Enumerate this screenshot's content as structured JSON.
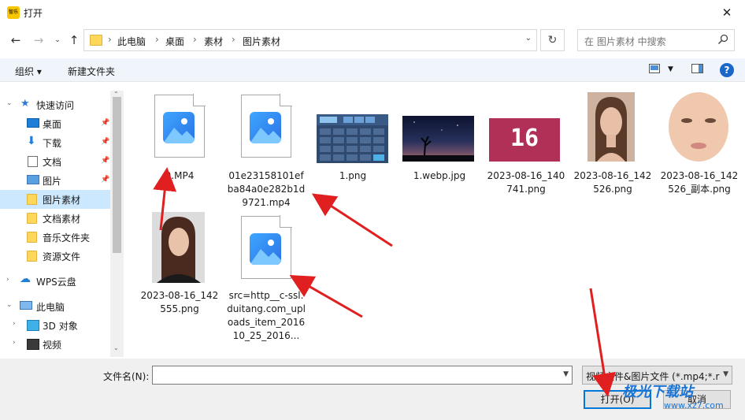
{
  "window": {
    "title": "打开",
    "app_icon_text": "智乐",
    "close_label": "✕"
  },
  "nav": {
    "breadcrumbs": [
      "此电脑",
      "桌面",
      "素材",
      "图片素材"
    ],
    "search_placeholder": "在 图片素材 中搜索"
  },
  "toolbar": {
    "organize": "组织",
    "new_folder": "新建文件夹",
    "help": "?"
  },
  "sidebar": {
    "items": [
      {
        "label": "快速访问",
        "icon": "star-icon"
      },
      {
        "label": "桌面",
        "icon": "desktop-icon"
      },
      {
        "label": "下载",
        "icon": "download-icon"
      },
      {
        "label": "文档",
        "icon": "document-icon"
      },
      {
        "label": "图片",
        "icon": "pictures-icon"
      },
      {
        "label": "图片素材",
        "icon": "folder-icon"
      },
      {
        "label": "文档素材",
        "icon": "folder-icon"
      },
      {
        "label": "音乐文件夹",
        "icon": "folder-icon"
      },
      {
        "label": "资源文件",
        "icon": "folder-icon"
      },
      {
        "label": "WPS云盘",
        "icon": "cloud-icon"
      },
      {
        "label": "此电脑",
        "icon": "computer-icon"
      },
      {
        "label": "3D 对象",
        "icon": "3d-objects-icon"
      },
      {
        "label": "视频",
        "icon": "video-icon"
      }
    ]
  },
  "files": [
    {
      "name": "0.MP4",
      "kind": "video"
    },
    {
      "name": "01e23158101efba84a0e282b1d9721.mp4",
      "kind": "video"
    },
    {
      "name": "1.png",
      "kind": "image-calculator"
    },
    {
      "name": "1.webp.jpg",
      "kind": "image-night"
    },
    {
      "name": "2023-08-16_140741.png",
      "kind": "image-16"
    },
    {
      "name": "2023-08-16_142526.png",
      "kind": "image-face"
    },
    {
      "name": "2023-08-16_142526_副本.png",
      "kind": "image-face-closeup"
    },
    {
      "name": "2023-08-16_142555.png",
      "kind": "image-portrait"
    },
    {
      "name": "src=http__c-ssl.duitang.com_uploads_item_201610_25_2016...",
      "kind": "video"
    }
  ],
  "thumb_text_16": "16",
  "bottom": {
    "filename_label": "文件名(N):",
    "filename_value": "",
    "filetype": "视频文件&图片文件 (*.mp4;*.r",
    "open_button": "打开(O)",
    "cancel_button": "取消"
  },
  "watermark": {
    "brand": "极光下载站",
    "url": "www.xz7.com"
  },
  "colors": {
    "accent": "#0078d7",
    "selected": "#cce8ff",
    "annotation": "#e02020"
  }
}
